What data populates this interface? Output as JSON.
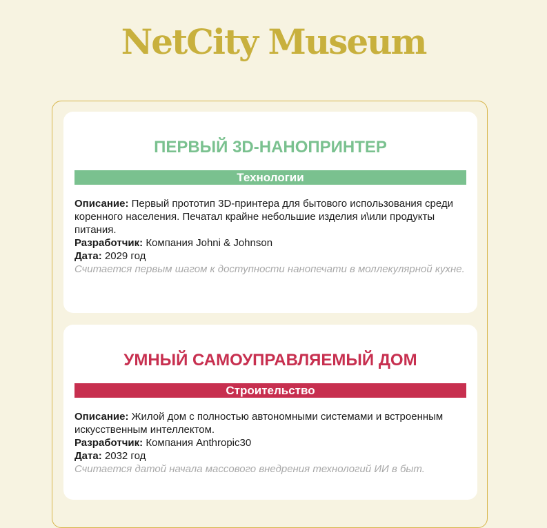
{
  "header": {
    "logo_text": "NetCity Museum"
  },
  "colors": {
    "background": "#f7f3e1",
    "logo": "#c8b03d",
    "border": "#d7b54a",
    "technology": "#7ac18f",
    "construction": "#c72f4f"
  },
  "labels": {
    "description": "Описание:",
    "developer": "Разработчик:",
    "date": "Дата:"
  },
  "exhibits": [
    {
      "title": "ПЕРВЫЙ 3D-НАНОПРИНТЕР",
      "category": "Технологии",
      "description": "Первый прототип 3D-принтера для бытового использования среди коренного населения. Печатал крайне небольшие изделия и\\или продукты питания.",
      "developer": "Компания Johni & Johnson",
      "date": "2029 год",
      "note": "Считается первым шагом к доступности нанопечати в моллекулярной кухне."
    },
    {
      "title": "УМНЫЙ САМОУПРАВЛЯЕМЫЙ ДОМ",
      "category": "Строительство",
      "description": "Жилой дом с полностью автономными системами и встроенным искусственным интеллектом.",
      "developer": "Компания Anthropic30",
      "date": "2032 год",
      "note": "Считается датой начала массового внедрения технологий ИИ в быт."
    }
  ]
}
